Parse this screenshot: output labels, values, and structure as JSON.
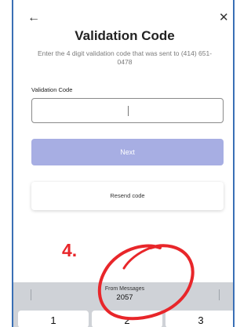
{
  "header": {
    "back_icon": "arrow-left-icon",
    "close_icon": "close-icon",
    "title": "Validation Code",
    "subtitle": "Enter the 4 digit validation code that was sent to (414) 651-0478"
  },
  "form": {
    "field_label": "Validation Code",
    "code_value": "",
    "next_label": "Next",
    "resend_label": "Resend code"
  },
  "annotation": {
    "step_label": "4.",
    "color": "#e8262a"
  },
  "keyboard": {
    "suggestion_source": "From Messages",
    "suggestion_code": "2057",
    "keys": [
      "1",
      "2",
      "3"
    ]
  },
  "colors": {
    "next_button": "#a7aee3",
    "frame_border": "#3a6fb5"
  }
}
